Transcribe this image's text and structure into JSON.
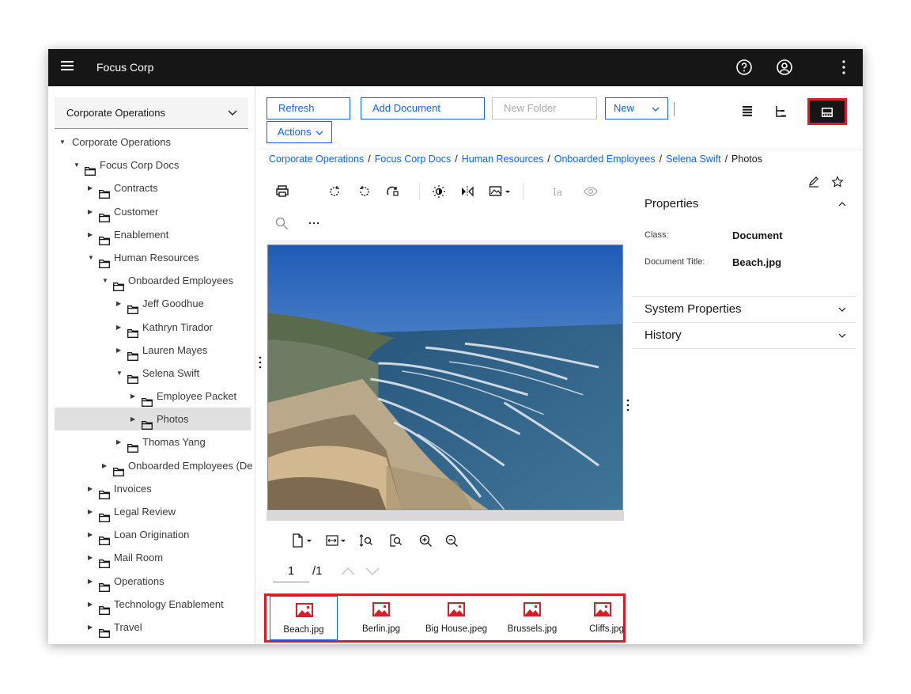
{
  "app": {
    "title": "Focus Corp"
  },
  "repository": {
    "selected": "Corporate Operations"
  },
  "tree": [
    {
      "label": "Corporate Operations",
      "level": 0,
      "expanded": true
    },
    {
      "label": "Focus Corp Docs",
      "level": 1,
      "expanded": true
    },
    {
      "label": "Contracts",
      "level": 2
    },
    {
      "label": "Customer",
      "level": 2
    },
    {
      "label": "Enablement",
      "level": 2
    },
    {
      "label": "Human Resources",
      "level": 2,
      "expanded": true
    },
    {
      "label": "Onboarded Employees",
      "level": 3,
      "expanded": true
    },
    {
      "label": "Jeff Goodhue",
      "level": 4
    },
    {
      "label": "Kathryn Tirador",
      "level": 4
    },
    {
      "label": "Lauren Mayes",
      "level": 4
    },
    {
      "label": "Selena Swift",
      "level": 4,
      "expanded": true
    },
    {
      "label": "Employee Packet",
      "level": 5
    },
    {
      "label": "Photos",
      "level": 5,
      "selected": true
    },
    {
      "label": "Thomas Yang",
      "level": 4
    },
    {
      "label": "Onboarded Employees (De",
      "level": 3
    },
    {
      "label": "Invoices",
      "level": 2
    },
    {
      "label": "Legal Review",
      "level": 2
    },
    {
      "label": "Loan Origination",
      "level": 2
    },
    {
      "label": "Mail Room",
      "level": 2
    },
    {
      "label": "Operations",
      "level": 2
    },
    {
      "label": "Technology Enablement",
      "level": 2
    },
    {
      "label": "Travel",
      "level": 2
    }
  ],
  "toolbar": {
    "refresh": "Refresh",
    "add_document": "Add Document",
    "new_folder": "New Folder",
    "new": "New",
    "actions": "Actions"
  },
  "breadcrumb": {
    "items": [
      "Corporate Operations",
      "Focus Corp Docs",
      "Human Resources",
      "Onboarded Employees",
      "Selena Swift"
    ],
    "current": "Photos",
    "separator": "/"
  },
  "viewer": {
    "page": "1",
    "total": "/1"
  },
  "properties": {
    "title": "Properties",
    "class_label": "Class:",
    "class_value": "Document",
    "doc_title_label": "Document Title:",
    "doc_title_value": "Beach.jpg",
    "system_properties": "System Properties",
    "history": "History"
  },
  "thumbnails": [
    {
      "label": "Beach.jpg",
      "selected": true
    },
    {
      "label": "Berlin.jpg"
    },
    {
      "label": "Big House.jpeg"
    },
    {
      "label": "Brussels.jpg"
    },
    {
      "label": "Cliffs.jpg"
    }
  ],
  "colors": {
    "accent": "#0f62fe",
    "highlight": "#da1e28",
    "topbar": "#161616",
    "thumb_icon": "#da1e28"
  }
}
